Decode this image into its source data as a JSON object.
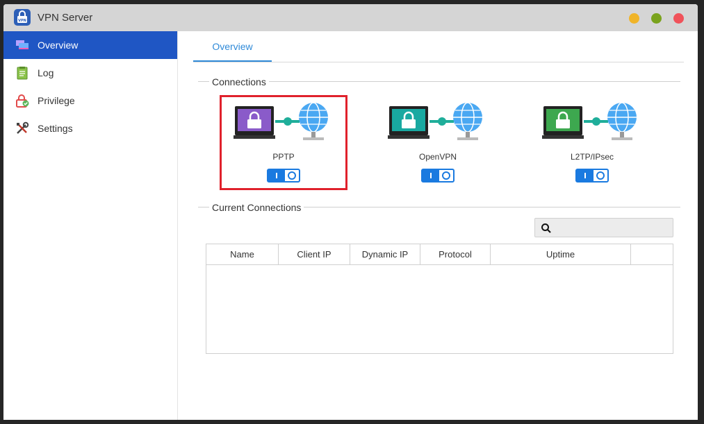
{
  "window": {
    "title": "VPN Server",
    "app_icon_text": "VPN"
  },
  "sidebar": {
    "items": [
      {
        "label": "Overview",
        "icon": "overview-icon",
        "active": true
      },
      {
        "label": "Log",
        "icon": "log-icon",
        "active": false
      },
      {
        "label": "Privilege",
        "icon": "privilege-icon",
        "active": false
      },
      {
        "label": "Settings",
        "icon": "settings-icon",
        "active": false
      }
    ]
  },
  "main": {
    "tabs": [
      {
        "label": "Overview",
        "active": true
      }
    ],
    "connections_title": "Connections",
    "connections": [
      {
        "label": "PPTP",
        "enabled": true,
        "screen_color": "#8a5bc9"
      },
      {
        "label": "OpenVPN",
        "enabled": true,
        "screen_color": "#19a9a1"
      },
      {
        "label": "L2TP/IPsec",
        "enabled": true,
        "screen_color": "#3da84f"
      }
    ],
    "current_connections_title": "Current Connections",
    "search": {
      "placeholder": "",
      "value": ""
    },
    "table": {
      "columns": [
        "Name",
        "Client IP",
        "Dynamic IP",
        "Protocol",
        "Uptime",
        ""
      ],
      "rows": []
    }
  },
  "colors": {
    "accent": "#1f56c4",
    "tab_accent": "#2f8ad8",
    "toggle": "#1a7ae0",
    "highlight": "#e0212c"
  }
}
